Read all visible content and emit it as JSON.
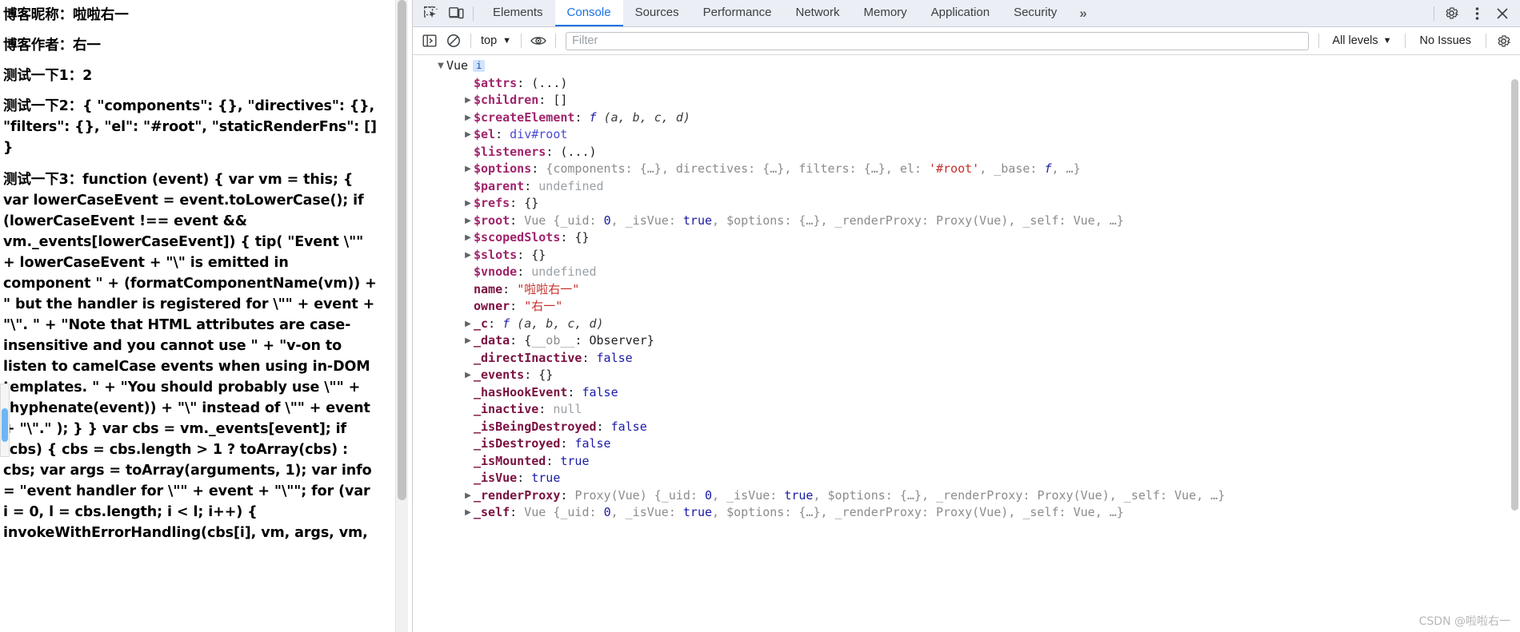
{
  "page": {
    "lines": [
      "博客昵称：啦啦右一",
      "博客作者：右一",
      "测试一下1：2",
      "测试一下2：{ \"components\": {}, \"directives\": {}, \"filters\": {}, \"el\": \"#root\", \"staticRenderFns\": [] }",
      "测试一下3：function (event) { var vm = this; { var lowerCaseEvent = event.toLowerCase(); if (lowerCaseEvent !== event && vm._events[lowerCaseEvent]) { tip( \"Event \\\"\" + lowerCaseEvent + \"\\\" is emitted in component \" + (formatComponentName(vm)) + \" but the handler is registered for \\\"\" + event + \"\\\". \" + \"Note that HTML attributes are case-insensitive and you cannot use \" + \"v-on to listen to camelCase events when using in-DOM templates. \" + \"You should probably use \\\"\" + (hyphenate(event)) + \"\\\" instead of \\\"\" + event + \"\\\".\" ); } } var cbs = vm._events[event]; if (cbs) { cbs = cbs.length > 1 ? toArray(cbs) : cbs; var args = toArray(arguments, 1); var info = \"event handler for \\\"\" + event + \"\\\"\"; for (var i = 0, l = cbs.length; i < l; i++) { invokeWithErrorHandling(cbs[i], vm, args, vm,"
    ]
  },
  "devtools": {
    "toolbar": {
      "inspect_icon": "inspect-element-icon",
      "device_icon": "device-toolbar-icon",
      "tabs": [
        {
          "label": "Elements",
          "active": false
        },
        {
          "label": "Console",
          "active": true
        },
        {
          "label": "Sources",
          "active": false
        },
        {
          "label": "Performance",
          "active": false
        },
        {
          "label": "Network",
          "active": false
        },
        {
          "label": "Memory",
          "active": false
        },
        {
          "label": "Application",
          "active": false
        },
        {
          "label": "Security",
          "active": false
        }
      ],
      "more_tabs": "»",
      "settings_icon": "gear-icon",
      "more_icon": "kebab-menu-icon",
      "close_icon": "close-icon"
    },
    "filterbar": {
      "sidebar_toggle_icon": "console-sidebar-icon",
      "clear_icon": "clear-console-icon",
      "context": "top",
      "context_caret": "▼",
      "eye_icon": "live-expression-icon",
      "filter_placeholder": "Filter",
      "filter_value": "",
      "levels": "All levels",
      "levels_caret": "▼",
      "issues": "No Issues",
      "issues_gear_icon": "issues-gear-icon"
    },
    "console": {
      "root_label": "Vue",
      "root_badge": "i",
      "rows": [
        {
          "expand": "collapsed-none",
          "indent": 1,
          "key": "$attrs",
          "keytype": "proto",
          "sep": ": ",
          "parts": [
            {
              "t": "(...)",
              "c": "punct"
            }
          ]
        },
        {
          "expand": "collapsed",
          "indent": 1,
          "key": "$children",
          "keytype": "proto",
          "sep": ": ",
          "parts": [
            {
              "t": "[]",
              "c": "punct"
            }
          ]
        },
        {
          "expand": "collapsed",
          "indent": 1,
          "key": "$createElement",
          "keytype": "proto",
          "sep": ": ",
          "parts": [
            {
              "t": "f",
              "c": "fn"
            },
            {
              "t": " (a, b, c, d)",
              "c": "fnargs"
            }
          ]
        },
        {
          "expand": "collapsed",
          "indent": 1,
          "key": "$el",
          "keytype": "proto",
          "sep": ": ",
          "parts": [
            {
              "t": "div#root",
              "c": "node"
            }
          ]
        },
        {
          "expand": "collapsed-none",
          "indent": 1,
          "key": "$listeners",
          "keytype": "proto",
          "sep": ": ",
          "parts": [
            {
              "t": "(...)",
              "c": "punct"
            }
          ]
        },
        {
          "expand": "collapsed",
          "indent": 1,
          "key": "$options",
          "keytype": "proto",
          "sep": ": ",
          "parts": [
            {
              "t": "{components: ",
              "c": "obj"
            },
            {
              "t": "{…}",
              "c": "obj"
            },
            {
              "t": ", directives: ",
              "c": "obj"
            },
            {
              "t": "{…}",
              "c": "obj"
            },
            {
              "t": ", filters: ",
              "c": "obj"
            },
            {
              "t": "{…}",
              "c": "obj"
            },
            {
              "t": ", el: ",
              "c": "obj"
            },
            {
              "t": "'#root'",
              "c": "str"
            },
            {
              "t": ", _base: ",
              "c": "obj"
            },
            {
              "t": "f",
              "c": "fn"
            },
            {
              "t": ", …}",
              "c": "obj"
            }
          ]
        },
        {
          "expand": "collapsed-none",
          "indent": 1,
          "key": "$parent",
          "keytype": "proto",
          "sep": ": ",
          "parts": [
            {
              "t": "undefined",
              "c": "undef"
            }
          ]
        },
        {
          "expand": "collapsed",
          "indent": 1,
          "key": "$refs",
          "keytype": "proto",
          "sep": ": ",
          "parts": [
            {
              "t": "{}",
              "c": "punct"
            }
          ]
        },
        {
          "expand": "collapsed",
          "indent": 1,
          "key": "$root",
          "keytype": "proto",
          "sep": ": ",
          "parts": [
            {
              "t": "Vue {_uid: ",
              "c": "obj"
            },
            {
              "t": "0",
              "c": "num"
            },
            {
              "t": ", _isVue: ",
              "c": "obj"
            },
            {
              "t": "true",
              "c": "bool"
            },
            {
              "t": ", $options: ",
              "c": "obj"
            },
            {
              "t": "{…}",
              "c": "obj"
            },
            {
              "t": ", _renderProxy: ",
              "c": "obj"
            },
            {
              "t": "Proxy(Vue)",
              "c": "obj"
            },
            {
              "t": ", _self: ",
              "c": "obj"
            },
            {
              "t": "Vue",
              "c": "obj"
            },
            {
              "t": ", …}",
              "c": "obj"
            }
          ]
        },
        {
          "expand": "collapsed",
          "indent": 1,
          "key": "$scopedSlots",
          "keytype": "proto",
          "sep": ": ",
          "parts": [
            {
              "t": "{}",
              "c": "punct"
            }
          ]
        },
        {
          "expand": "collapsed",
          "indent": 1,
          "key": "$slots",
          "keytype": "proto",
          "sep": ": ",
          "parts": [
            {
              "t": "{}",
              "c": "punct"
            }
          ]
        },
        {
          "expand": "collapsed-none",
          "indent": 1,
          "key": "$vnode",
          "keytype": "proto",
          "sep": ": ",
          "parts": [
            {
              "t": "undefined",
              "c": "undef"
            }
          ]
        },
        {
          "expand": "collapsed-none",
          "indent": 1,
          "key": "name",
          "keytype": "own",
          "sep": ": ",
          "parts": [
            {
              "t": "\"啦啦右一\"",
              "c": "str"
            }
          ]
        },
        {
          "expand": "collapsed-none",
          "indent": 1,
          "key": "owner",
          "keytype": "own",
          "sep": ": ",
          "parts": [
            {
              "t": "\"右一\"",
              "c": "str"
            }
          ]
        },
        {
          "expand": "collapsed",
          "indent": 1,
          "key": "_c",
          "keytype": "own",
          "sep": ": ",
          "parts": [
            {
              "t": "f",
              "c": "fn"
            },
            {
              "t": " (a, b, c, d)",
              "c": "fnargs"
            }
          ]
        },
        {
          "expand": "collapsed",
          "indent": 1,
          "key": "_data",
          "keytype": "own",
          "sep": ": ",
          "parts": [
            {
              "t": "{",
              "c": "punct"
            },
            {
              "t": "__ob__",
              "c": "obj"
            },
            {
              "t": ": Observer}",
              "c": "punct"
            }
          ]
        },
        {
          "expand": "collapsed-none",
          "indent": 1,
          "key": "_directInactive",
          "keytype": "own",
          "sep": ": ",
          "parts": [
            {
              "t": "false",
              "c": "bool"
            }
          ]
        },
        {
          "expand": "collapsed",
          "indent": 1,
          "key": "_events",
          "keytype": "own",
          "sep": ": ",
          "parts": [
            {
              "t": "{}",
              "c": "punct"
            }
          ]
        },
        {
          "expand": "collapsed-none",
          "indent": 1,
          "key": "_hasHookEvent",
          "keytype": "own",
          "sep": ": ",
          "parts": [
            {
              "t": "false",
              "c": "bool"
            }
          ]
        },
        {
          "expand": "collapsed-none",
          "indent": 1,
          "key": "_inactive",
          "keytype": "own",
          "sep": ": ",
          "parts": [
            {
              "t": "null",
              "c": "undef"
            }
          ]
        },
        {
          "expand": "collapsed-none",
          "indent": 1,
          "key": "_isBeingDestroyed",
          "keytype": "own",
          "sep": ": ",
          "parts": [
            {
              "t": "false",
              "c": "bool"
            }
          ]
        },
        {
          "expand": "collapsed-none",
          "indent": 1,
          "key": "_isDestroyed",
          "keytype": "own",
          "sep": ": ",
          "parts": [
            {
              "t": "false",
              "c": "bool"
            }
          ]
        },
        {
          "expand": "collapsed-none",
          "indent": 1,
          "key": "_isMounted",
          "keytype": "own",
          "sep": ": ",
          "parts": [
            {
              "t": "true",
              "c": "bool"
            }
          ]
        },
        {
          "expand": "collapsed-none",
          "indent": 1,
          "key": "_isVue",
          "keytype": "own",
          "sep": ": ",
          "parts": [
            {
              "t": "true",
              "c": "bool"
            }
          ]
        },
        {
          "expand": "collapsed",
          "indent": 1,
          "key": "_renderProxy",
          "keytype": "own",
          "sep": ": ",
          "parts": [
            {
              "t": "Proxy(Vue) {_uid: ",
              "c": "obj"
            },
            {
              "t": "0",
              "c": "num"
            },
            {
              "t": ", _isVue: ",
              "c": "obj"
            },
            {
              "t": "true",
              "c": "bool"
            },
            {
              "t": ", $options: ",
              "c": "obj"
            },
            {
              "t": "{…}",
              "c": "obj"
            },
            {
              "t": ", _renderProxy: ",
              "c": "obj"
            },
            {
              "t": "Proxy(Vue)",
              "c": "obj"
            },
            {
              "t": ", _self: ",
              "c": "obj"
            },
            {
              "t": "Vue",
              "c": "obj"
            },
            {
              "t": ", …}",
              "c": "obj"
            }
          ]
        },
        {
          "expand": "collapsed",
          "indent": 1,
          "key": "_self",
          "keytype": "own",
          "sep": ": ",
          "parts": [
            {
              "t": "Vue {_uid: ",
              "c": "obj"
            },
            {
              "t": "0",
              "c": "num"
            },
            {
              "t": ", _isVue: ",
              "c": "obj"
            },
            {
              "t": "true",
              "c": "bool"
            },
            {
              "t": ", $options: ",
              "c": "obj"
            },
            {
              "t": "{…}",
              "c": "obj"
            },
            {
              "t": ", _renderProxy: ",
              "c": "obj"
            },
            {
              "t": "Proxy(Vue)",
              "c": "obj"
            },
            {
              "t": ", _self: ",
              "c": "obj"
            },
            {
              "t": "Vue",
              "c": "obj"
            },
            {
              "t": ", …}",
              "c": "obj"
            }
          ]
        }
      ]
    }
  },
  "watermark": "CSDN @啦啦右一"
}
